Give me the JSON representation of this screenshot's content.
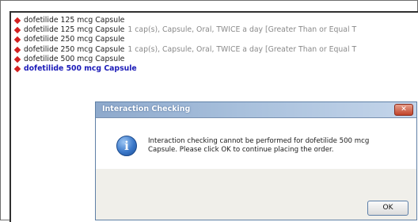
{
  "orders": [
    {
      "name": "dofetilide 125 mcg Capsule",
      "detail": ""
    },
    {
      "name": "dofetilide 125 mcg Capsule",
      "detail": "1 cap(s), Capsule, Oral, TWICE a day [Greater Than or Equal T"
    },
    {
      "name": "dofetilide 250 mcg Capsule",
      "detail": ""
    },
    {
      "name": "dofetilide 250 mcg Capsule",
      "detail": "1 cap(s), Capsule, Oral, TWICE a day [Greater Than or Equal T"
    },
    {
      "name": "dofetilide 500 mcg Capsule",
      "detail": ""
    },
    {
      "name": "dofetilide 500 mcg Capsule",
      "detail": ""
    }
  ],
  "dialog": {
    "title": "Interaction Checking",
    "message_line1": "Interaction checking cannot be performed for dofetilide 500 mcg",
    "message_line2": "Capsule.  Please click OK to continue placing the order.",
    "ok_label": "OK",
    "close_label": "✕",
    "icon_glyph": "i"
  },
  "colors": {
    "bullet": "#d42020",
    "selected_text": "#1a1ab8",
    "title_bar": "#a8c0dc"
  }
}
